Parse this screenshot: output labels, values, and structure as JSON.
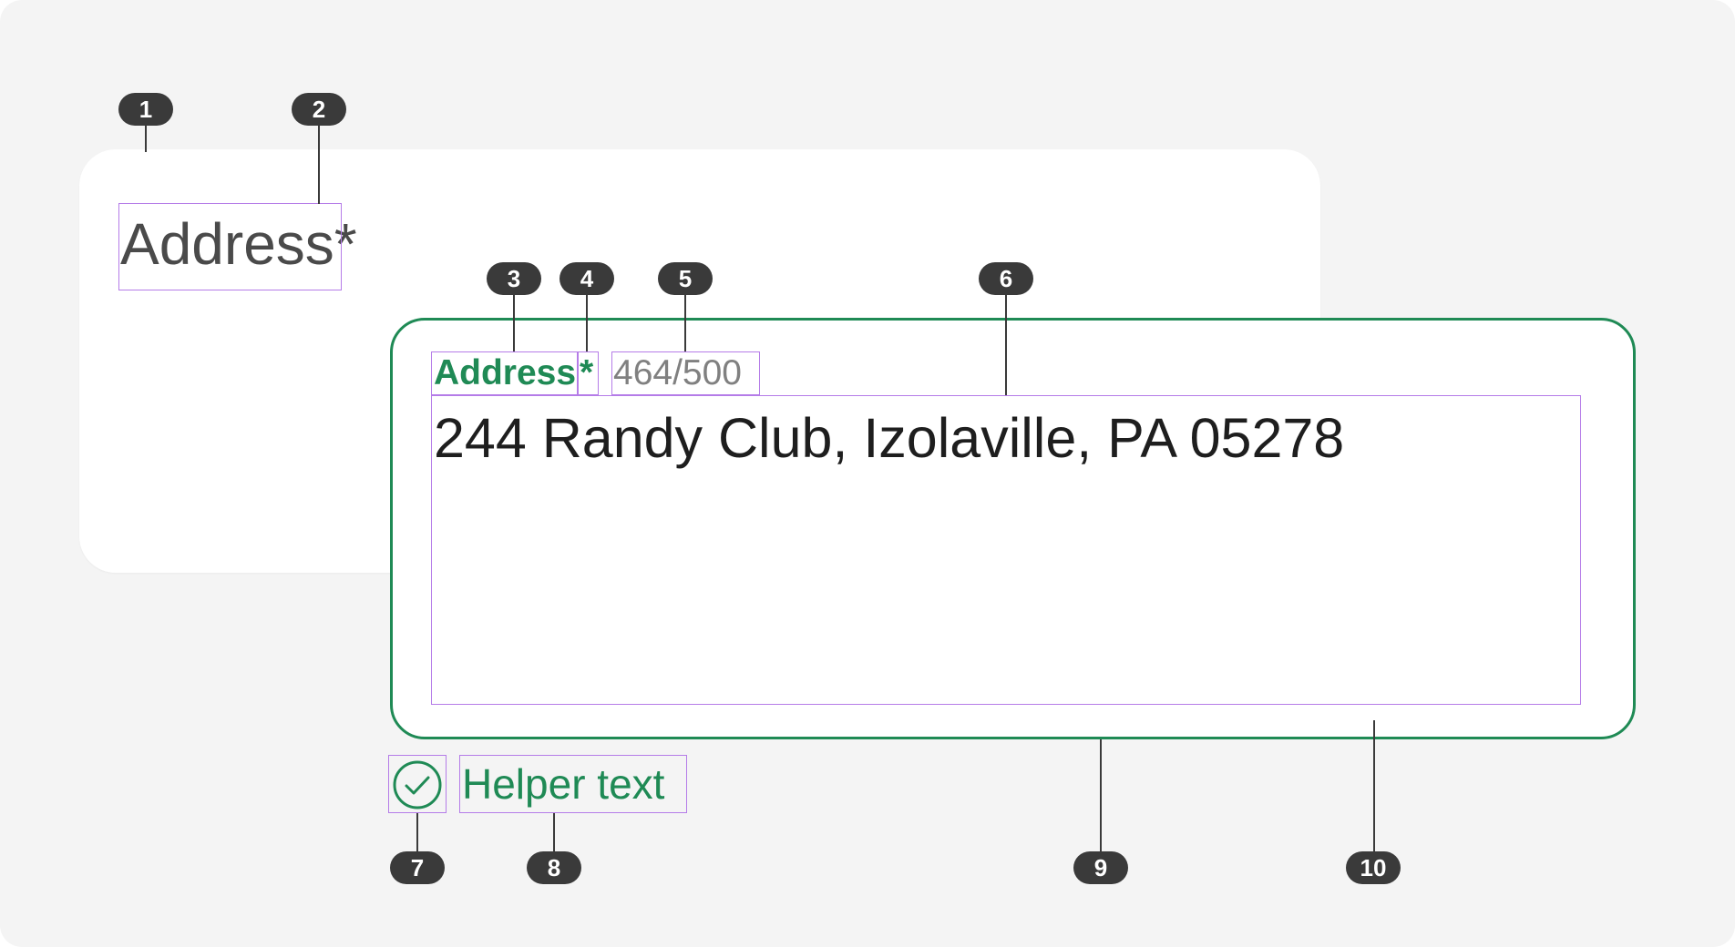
{
  "background_card": {
    "label": "Address",
    "required_mark": "*"
  },
  "text_area": {
    "label": "Address",
    "required_mark": "*",
    "char_counter": "464/500",
    "value": "244 Randy Club, Izolaville, PA 05278",
    "helper_text": "Helper text",
    "helper_icon": "check-circle-icon"
  },
  "markers": [
    "1",
    "2",
    "3",
    "4",
    "5",
    "6",
    "7",
    "8",
    "9",
    "10"
  ],
  "colors": {
    "success": "#1f8a55",
    "outline": "#b57ce8",
    "marker": "#3a3a3a",
    "canvas": "#f4f4f4",
    "counter": "#808080"
  }
}
